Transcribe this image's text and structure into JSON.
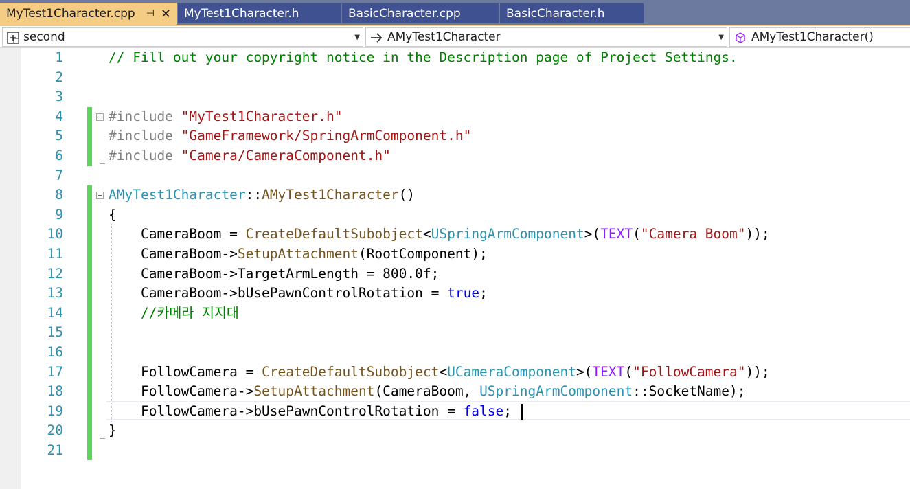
{
  "tabs": [
    {
      "label": "MyTest1Character.cpp",
      "pin": "⊣",
      "close": "✕"
    },
    {
      "label": "MyTest1Character.h"
    },
    {
      "label": "BasicCharacter.cpp"
    },
    {
      "label": "BasicCharacter.h"
    }
  ],
  "nav": {
    "project": {
      "value": "second",
      "icon": "project-icon"
    },
    "scope": {
      "value": "AMyTest1Character",
      "icon": "arrow-right-icon"
    },
    "member": {
      "value": "AMyTest1Character()",
      "icon": "method-cube-icon"
    }
  },
  "editor": {
    "line_numbers": [
      "1",
      "2",
      "3",
      "4",
      "5",
      "6",
      "7",
      "8",
      "9",
      "10",
      "11",
      "12",
      "13",
      "14",
      "15",
      "16",
      "17",
      "18",
      "19",
      "20",
      "21"
    ],
    "lines": [
      [
        {
          "t": "// Fill out your copyright notice in the Description page of Project Settings.",
          "k": "cm"
        }
      ],
      [],
      [],
      [
        {
          "t": "#include ",
          "k": "pp"
        },
        {
          "t": "\"MyTest1Character.h\"",
          "k": "st"
        }
      ],
      [
        {
          "t": "#include ",
          "k": "pp"
        },
        {
          "t": "\"GameFramework/SpringArmComponent.h\"",
          "k": "st"
        }
      ],
      [
        {
          "t": "#include ",
          "k": "pp"
        },
        {
          "t": "\"Camera/CameraComponent.h\"",
          "k": "st"
        }
      ],
      [],
      [
        {
          "t": "AMyTest1Character",
          "k": "ty"
        },
        {
          "t": "::",
          "k": "pl"
        },
        {
          "t": "AMyTest1Character",
          "k": "fn"
        },
        {
          "t": "()",
          "k": "pl"
        }
      ],
      [
        {
          "t": "{",
          "k": "pl"
        }
      ],
      [
        {
          "t": "    CameraBoom = ",
          "k": "pl"
        },
        {
          "t": "CreateDefaultSubobject",
          "k": "fn"
        },
        {
          "t": "<",
          "k": "pl"
        },
        {
          "t": "USpringArmComponent",
          "k": "ty"
        },
        {
          "t": ">(",
          "k": "pl"
        },
        {
          "t": "TEXT",
          "k": "mc"
        },
        {
          "t": "(",
          "k": "pl"
        },
        {
          "t": "\"Camera Boom\"",
          "k": "st"
        },
        {
          "t": "));",
          "k": "pl"
        }
      ],
      [
        {
          "t": "    CameraBoom->",
          "k": "pl"
        },
        {
          "t": "SetupAttachment",
          "k": "fn"
        },
        {
          "t": "(RootComponent);",
          "k": "pl"
        }
      ],
      [
        {
          "t": "    CameraBoom->TargetArmLength = 800.0f;",
          "k": "pl"
        }
      ],
      [
        {
          "t": "    CameraBoom->bUsePawnControlRotation = ",
          "k": "pl"
        },
        {
          "t": "true",
          "k": "kw"
        },
        {
          "t": ";",
          "k": "pl"
        }
      ],
      [
        {
          "t": "    //카메라 지지대",
          "k": "cm"
        }
      ],
      [],
      [],
      [
        {
          "t": "    FollowCamera = ",
          "k": "pl"
        },
        {
          "t": "CreateDefaultSubobject",
          "k": "fn"
        },
        {
          "t": "<",
          "k": "pl"
        },
        {
          "t": "UCameraComponent",
          "k": "ty"
        },
        {
          "t": ">(",
          "k": "pl"
        },
        {
          "t": "TEXT",
          "k": "mc"
        },
        {
          "t": "(",
          "k": "pl"
        },
        {
          "t": "\"FollowCamera\"",
          "k": "st"
        },
        {
          "t": "));",
          "k": "pl"
        }
      ],
      [
        {
          "t": "    FollowCamera->",
          "k": "pl"
        },
        {
          "t": "SetupAttachment",
          "k": "fn"
        },
        {
          "t": "(CameraBoom, ",
          "k": "pl"
        },
        {
          "t": "USpringArmComponent",
          "k": "ty"
        },
        {
          "t": "::SocketName);",
          "k": "pl"
        }
      ],
      [
        {
          "t": "    FollowCamera->bUsePawnControlRotation = ",
          "k": "pl"
        },
        {
          "t": "false",
          "k": "kw"
        },
        {
          "t": ";",
          "k": "pl"
        }
      ],
      [
        {
          "t": "}",
          "k": "pl"
        }
      ],
      []
    ],
    "cursor_line": 19
  }
}
